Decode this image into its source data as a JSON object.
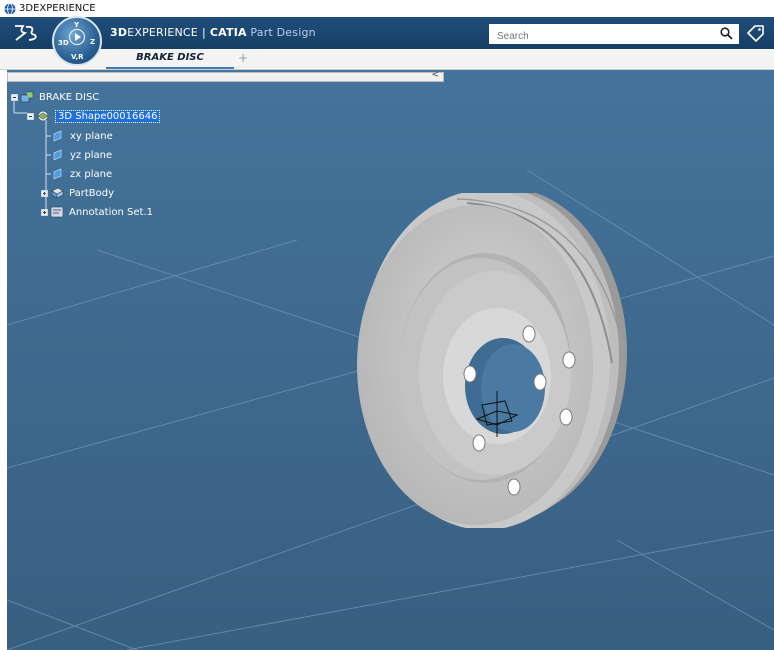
{
  "window": {
    "title": "3DEXPERIENCE"
  },
  "header": {
    "brand_bold": "3D",
    "brand_rest": "EXPERIENCE",
    "separator": "|",
    "app": "CATIA",
    "module": "Part Design",
    "compass": {
      "top": "Y",
      "left": "3D",
      "right": "Z",
      "bottom": "V,R"
    },
    "search_placeholder": "Search"
  },
  "tabs": [
    {
      "label": "BRAKE DISC",
      "active": true
    }
  ],
  "tab_add_label": "+",
  "panel": {
    "collapse_label": "<"
  },
  "tree": {
    "root": {
      "label": "BRAKE DISC"
    },
    "shape": {
      "label": "3D Shape00016646",
      "selected": true
    },
    "children": [
      {
        "label": "xy plane",
        "icon": "plane-icon"
      },
      {
        "label": "yz plane",
        "icon": "plane-icon"
      },
      {
        "label": "zx plane",
        "icon": "plane-icon"
      },
      {
        "label": "PartBody",
        "icon": "body-icon"
      },
      {
        "label": "Annotation Set.1",
        "icon": "annotation-icon"
      }
    ]
  },
  "colors": {
    "viewport": "#3f6f97",
    "topbar": "#1f4e7a",
    "selection": "#1e6fd9"
  }
}
